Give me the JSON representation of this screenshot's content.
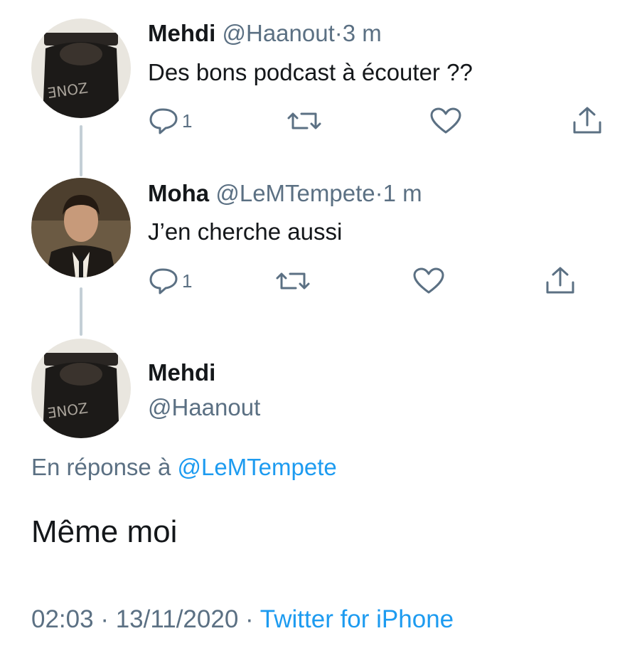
{
  "tweets": [
    {
      "name": "Mehdi",
      "handle": "@Haanout",
      "sep": "·",
      "time": "3 m",
      "text": "Des bons podcast à écouter ??",
      "reply_count": "1"
    },
    {
      "name": "Moha",
      "handle": "@LeMTempete",
      "sep": "·",
      "time": "1 m",
      "text": "J’en cherche aussi",
      "reply_count": "1"
    }
  ],
  "main": {
    "name": "Mehdi",
    "handle": "@Haanout",
    "reply_prefix": "En réponse à",
    "reply_handle": "@LeMTempete",
    "text": "Même moi",
    "time": "02:03",
    "sep": "·",
    "date": "13/11/2020",
    "sep2": "·",
    "source": "Twitter for iPhone"
  },
  "colors": {
    "accent": "#1d9bf0",
    "muted": "#5b7083",
    "text": "#14171a"
  },
  "icons": [
    "reply-icon",
    "retweet-icon",
    "like-icon",
    "share-icon"
  ]
}
